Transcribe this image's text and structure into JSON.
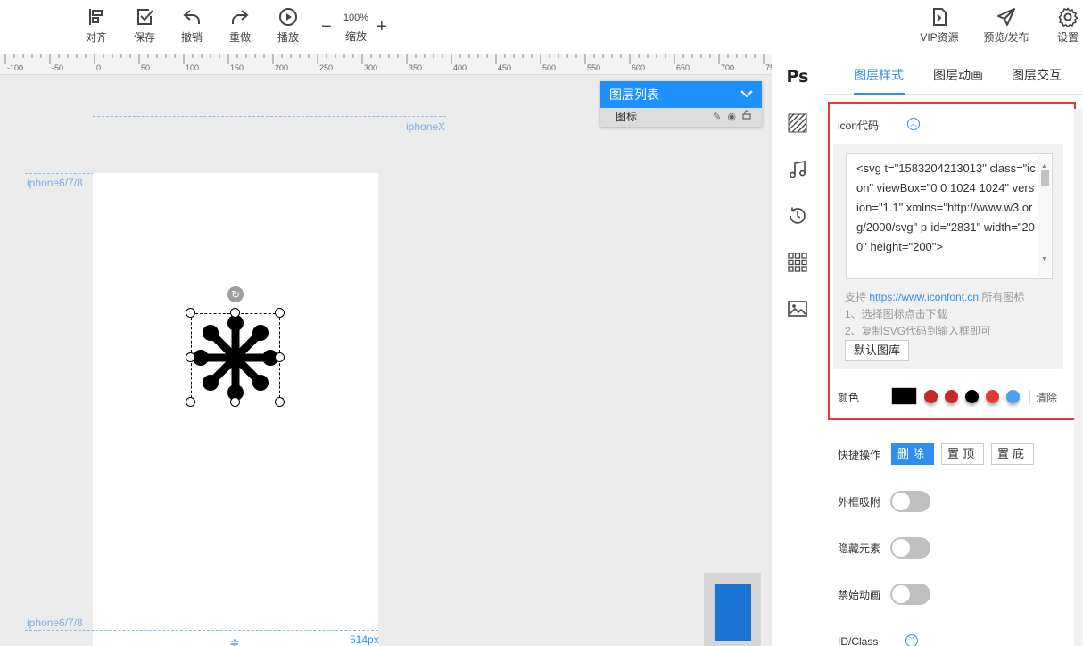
{
  "toolbar": {
    "left": [
      {
        "label": "对齐",
        "icon": "align-icon"
      },
      {
        "label": "保存",
        "icon": "save-icon"
      },
      {
        "label": "撤销",
        "icon": "undo-icon"
      },
      {
        "label": "重做",
        "icon": "redo-icon"
      },
      {
        "label": "播放",
        "icon": "play-icon"
      }
    ],
    "zoom": {
      "value": "100%",
      "label": "缩放",
      "minus": "−",
      "plus": "+"
    },
    "right": [
      {
        "label": "VIP资源",
        "icon": "vip-resource-icon"
      },
      {
        "label": "预览/发布",
        "icon": "send-icon"
      },
      {
        "label": "设置",
        "icon": "gear-icon"
      }
    ]
  },
  "ruler": {
    "ticks": [
      "-100",
      "-50",
      "0",
      "50",
      "100",
      "150",
      "200",
      "250",
      "300",
      "350",
      "400",
      "450",
      "500",
      "550",
      "600",
      "650",
      "700",
      "75"
    ]
  },
  "canvas": {
    "guides": {
      "iphonex": "iphoneX",
      "iphone678_top": "iphone6/7/8",
      "iphone678_bottom": "iphone6/7/8"
    },
    "width_label": "514px"
  },
  "layer_panel": {
    "title": "图层列表",
    "row_name": "图标"
  },
  "tool_strip": {
    "ps_label": "Ps"
  },
  "right_panel": {
    "tabs": [
      {
        "label": "图层样式",
        "active": true
      },
      {
        "label": "图层动画",
        "active": false
      },
      {
        "label": "图层交互",
        "active": false
      }
    ],
    "icon_code": {
      "label": "icon代码",
      "code": "<svg t=\"1583204213013\" class=\"icon\" viewBox=\"0 0 1024 1024\" version=\"1.1\" xmlns=\"http://www.w3.org/2000/svg\" p-id=\"2831\" width=\"200\" height=\"200\">",
      "support_prefix": "支持 ",
      "support_link": "https://www.iconfont.cn",
      "support_suffix": " 所有图标",
      "step1": "1、选择图标点击下载",
      "step2": "2、复制SVG代码到输入框即可",
      "default_button": "默认图库"
    },
    "color": {
      "label": "颜色",
      "current": "#000000",
      "presets": [
        "#c62828",
        "#c62828",
        "#000000",
        "#e53935",
        "#4a9ff5"
      ],
      "clear_label": "清除"
    },
    "quick_ops": {
      "label": "快捷操作",
      "delete": "删除",
      "top": "置顶",
      "bottom": "置底"
    },
    "toggles": [
      {
        "label": "外框吸附",
        "on": false
      },
      {
        "label": "隐藏元素",
        "on": false
      },
      {
        "label": "禁始动画",
        "on": false
      }
    ],
    "id_class_label": "ID/Class"
  },
  "colors": {
    "accent": "#2f8ef0",
    "highlight_border": "#e53935",
    "layer_header": "#1e90ff"
  }
}
